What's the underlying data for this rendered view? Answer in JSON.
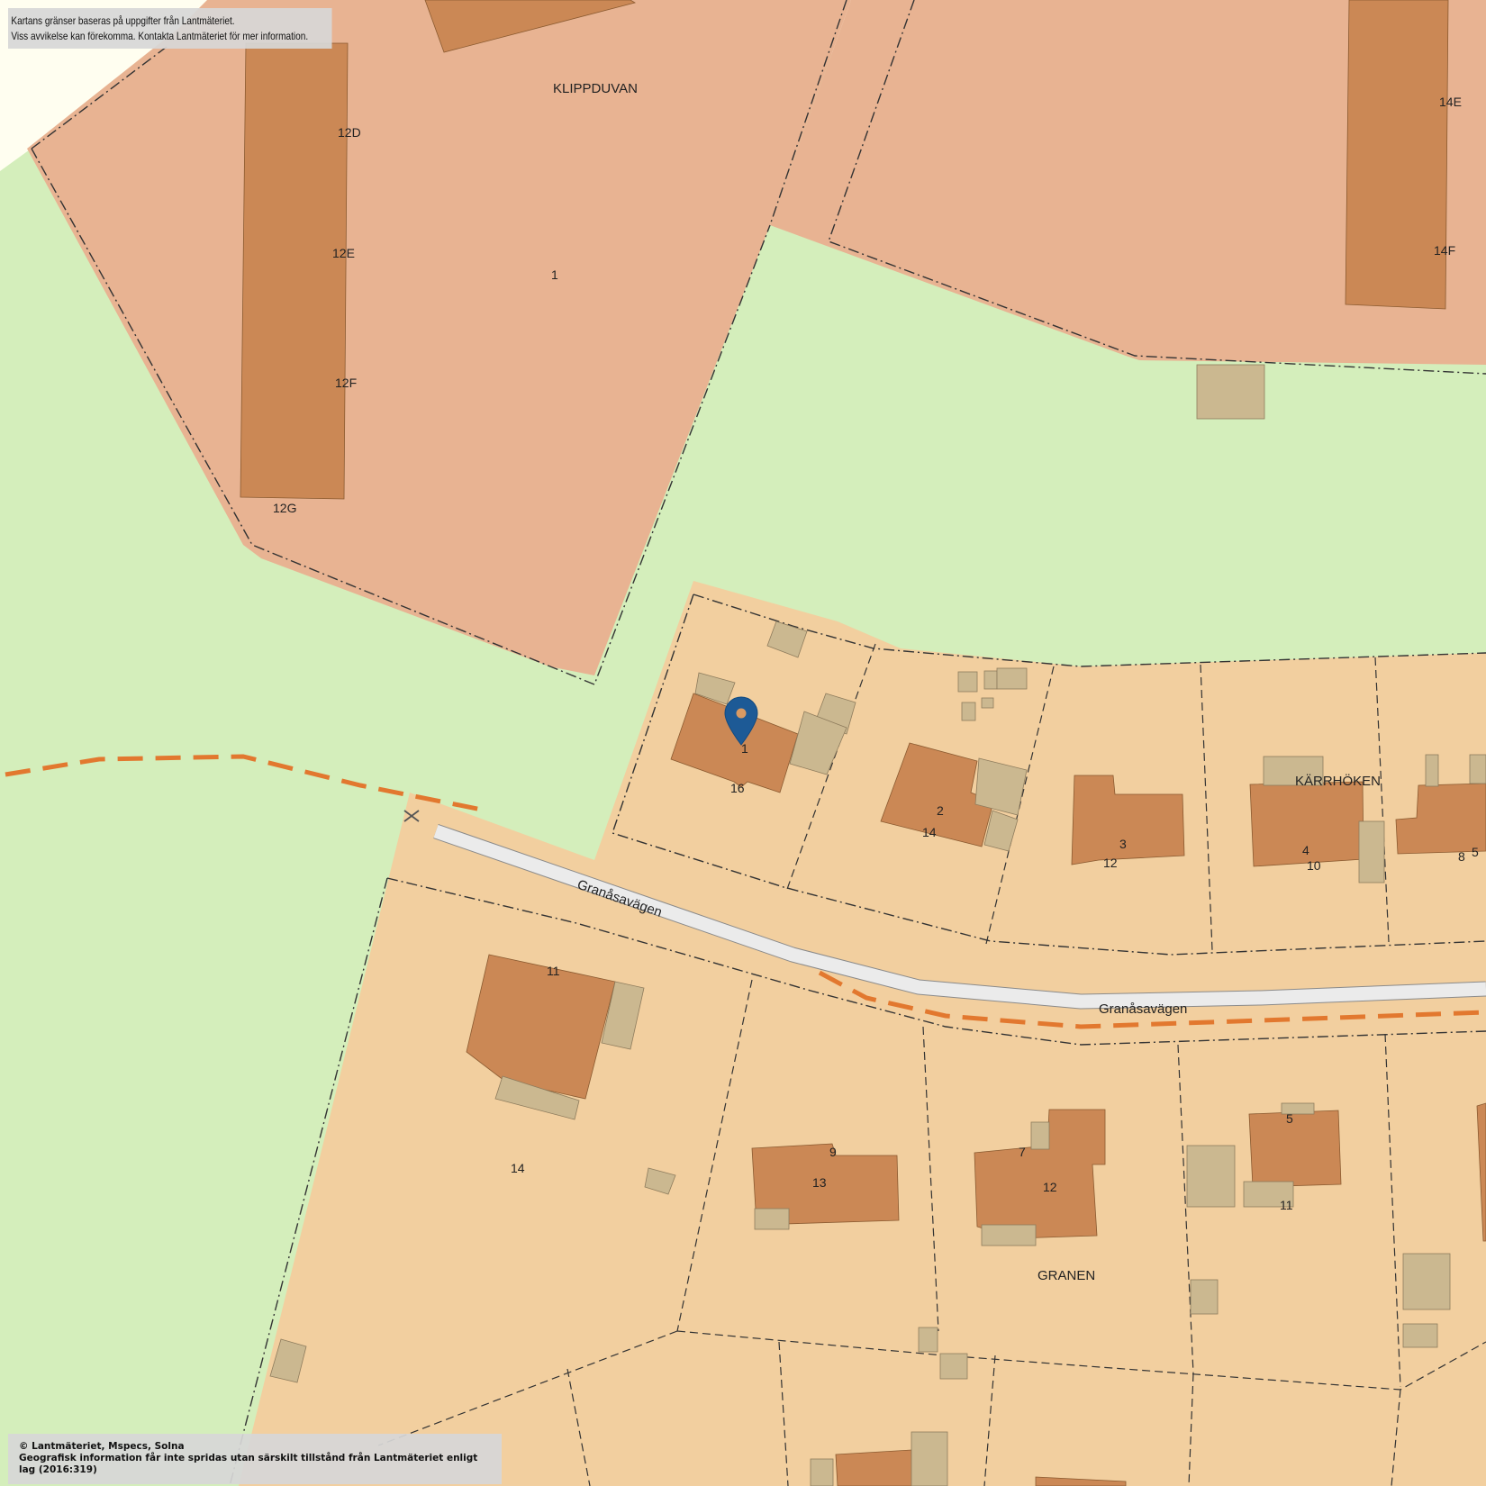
{
  "notice_top": {
    "line1": "Kartans gränser baseras på uppgifter från Lantmäteriet.",
    "line2": "Viss avvikelse kan förekomma. Kontakta Lantmäteriet för mer information."
  },
  "notice_bottom": {
    "line1": "© Lantmäteriet, Mspecs, Solna",
    "line2": "Geografisk information får inte spridas utan särskilt tillstånd från Lantmäteriet enligt lag (2016:319)"
  },
  "areas": {
    "klippduvan": "KLIPPDUVAN",
    "karrhoken": "KÄRRHÖKEN",
    "granen": "GRANEN"
  },
  "road": {
    "name_1": "Granåsavägen",
    "name_2": "Granåsavägen"
  },
  "labels": {
    "l12d": "12D",
    "l12e": "12E",
    "l12f": "12F",
    "l12g": "12G",
    "l1_top": "1",
    "l14e": "14E",
    "l14f": "14F",
    "p1": "1",
    "p16": "16",
    "p2": "2",
    "p14a": "14",
    "p3": "3",
    "p12a": "12",
    "p4": "4",
    "p10": "10",
    "p8": "8",
    "p5a": "5",
    "p11a": "11",
    "p14b": "14",
    "p9": "9",
    "p13": "13",
    "p7": "7",
    "p12b": "12",
    "p5b": "5",
    "p11b": "11"
  },
  "marker": {
    "icon": "map-pin-icon",
    "color": "#1d5a96"
  },
  "colors": {
    "residential": "#f2cf9f",
    "dense": "#e8b392",
    "green": "#d4eebb",
    "building": "#cb8855",
    "annex": "#cbb890",
    "road": "#ebebeb",
    "path": "#e2782f"
  }
}
